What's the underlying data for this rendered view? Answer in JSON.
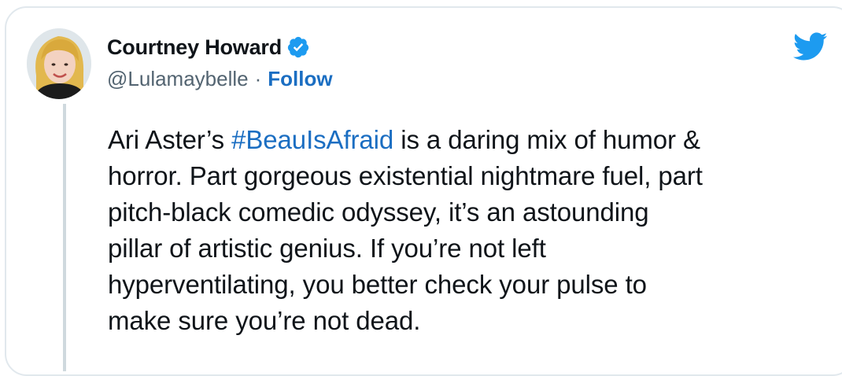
{
  "author": {
    "display_name": "Courtney Howard",
    "handle": "@Lulamaybelle",
    "separator": "·",
    "follow_label": "Follow",
    "verified_icon": "verified-badge-icon",
    "avatar": "avatar"
  },
  "brand": {
    "icon": "twitter-bird-icon",
    "color": "#1d9bf0"
  },
  "tweet": {
    "line1_pre": "Ari Aster’s ",
    "hashtag": "#BeauIsAfraid",
    "line1_post": " is a daring mix of humor &",
    "line2": "horror. Part gorgeous existential nightmare fuel, part",
    "line3": "pitch-black comedic odyssey, it’s an astounding",
    "line4": "pillar of artistic genius. If you’re not left",
    "line5": "hyperventilating, you better check your pulse to",
    "line6": "make sure you’re not dead."
  },
  "colors": {
    "link": "#1b6ec2",
    "text": "#0f1419",
    "secondary": "#536471",
    "border": "#e1e8ed"
  }
}
